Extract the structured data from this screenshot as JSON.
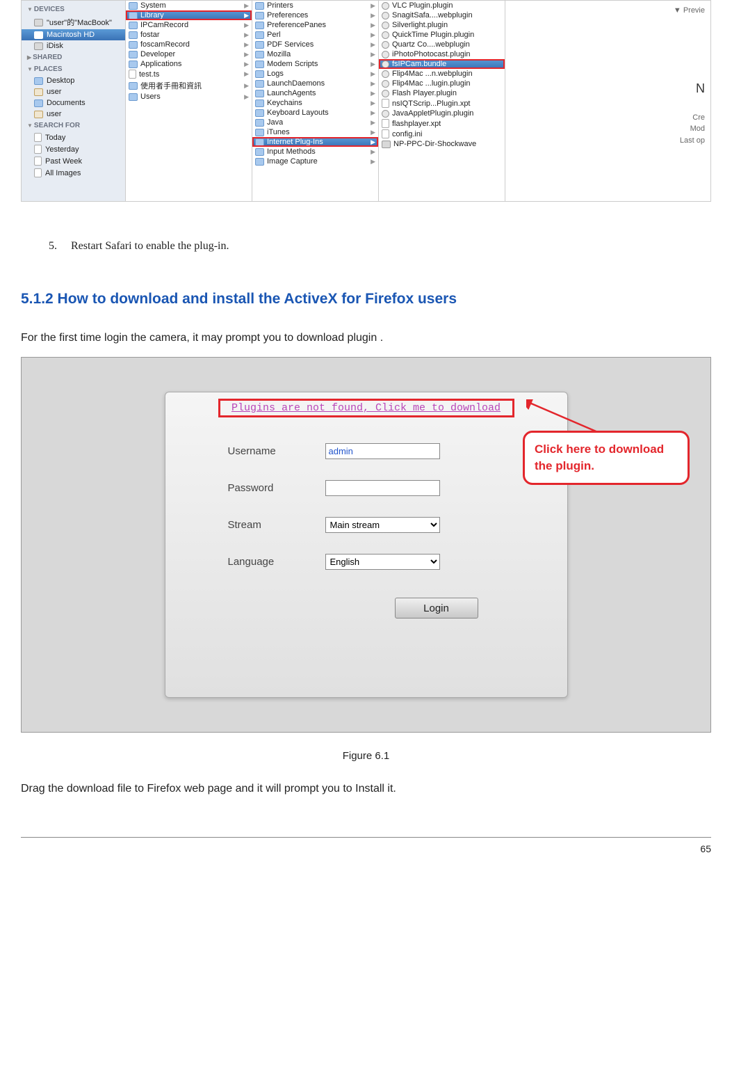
{
  "finder": {
    "sidebar": {
      "sections": [
        {
          "header": "DEVICES",
          "items": [
            {
              "icon": "disk-i",
              "label": "\"user\"的\"MacBook\""
            },
            {
              "icon": "disk-i",
              "label": "Macintosh HD",
              "selected": true
            },
            {
              "icon": "disk-i",
              "label": "iDisk"
            }
          ]
        },
        {
          "header": "SHARED",
          "items": []
        },
        {
          "header": "PLACES",
          "items": [
            {
              "icon": "folder-i",
              "label": "Desktop"
            },
            {
              "icon": "home-i",
              "label": "user"
            },
            {
              "icon": "folder-i",
              "label": "Documents"
            },
            {
              "icon": "home-i",
              "label": "user"
            }
          ]
        },
        {
          "header": "SEARCH FOR",
          "items": [
            {
              "icon": "file-i",
              "label": "Today"
            },
            {
              "icon": "file-i",
              "label": "Yesterday"
            },
            {
              "icon": "file-i",
              "label": "Past Week"
            },
            {
              "icon": "file-i",
              "label": "All Images"
            }
          ]
        }
      ]
    },
    "col1": [
      {
        "label": "System",
        "type": "folder"
      },
      {
        "label": "Library",
        "type": "folder",
        "selected": true,
        "highlighted": true
      },
      {
        "label": "IPCamRecord",
        "type": "folder"
      },
      {
        "label": "fostar",
        "type": "folder"
      },
      {
        "label": "foscamRecord",
        "type": "folder"
      },
      {
        "label": "Developer",
        "type": "folder"
      },
      {
        "label": "Applications",
        "type": "folder"
      },
      {
        "label": "test.ts",
        "type": "file"
      },
      {
        "label": "使用者手冊和資訊",
        "type": "folder"
      },
      {
        "label": "Users",
        "type": "folder"
      }
    ],
    "col2": [
      {
        "label": "Printers",
        "type": "folder"
      },
      {
        "label": "Preferences",
        "type": "folder"
      },
      {
        "label": "PreferencePanes",
        "type": "folder"
      },
      {
        "label": "Perl",
        "type": "folder"
      },
      {
        "label": "PDF Services",
        "type": "folder"
      },
      {
        "label": "Mozilla",
        "type": "folder"
      },
      {
        "label": "Modem Scripts",
        "type": "folder"
      },
      {
        "label": "Logs",
        "type": "folder"
      },
      {
        "label": "LaunchDaemons",
        "type": "folder"
      },
      {
        "label": "LaunchAgents",
        "type": "folder"
      },
      {
        "label": "Keychains",
        "type": "folder"
      },
      {
        "label": "Keyboard Layouts",
        "type": "folder"
      },
      {
        "label": "Java",
        "type": "folder"
      },
      {
        "label": "iTunes",
        "type": "folder"
      },
      {
        "label": "Internet Plug-Ins",
        "type": "folder",
        "selected": true,
        "highlighted": true
      },
      {
        "label": "Input Methods",
        "type": "folder"
      },
      {
        "label": "Image Capture",
        "type": "folder"
      }
    ],
    "col3": [
      {
        "label": "VLC Plugin.plugin",
        "type": "plugin"
      },
      {
        "label": "SnagitSafa....webplugin",
        "type": "plugin"
      },
      {
        "label": "Silverlight.plugin",
        "type": "plugin"
      },
      {
        "label": "QuickTime Plugin.plugin",
        "type": "plugin"
      },
      {
        "label": "Quartz Co....webplugin",
        "type": "plugin"
      },
      {
        "label": "iPhotoPhotocast.plugin",
        "type": "plugin"
      },
      {
        "label": "fsIPCam.bundle",
        "type": "plugin",
        "selected": true,
        "highlighted": true
      },
      {
        "label": "Flip4Mac ...n.webplugin",
        "type": "plugin"
      },
      {
        "label": "Flip4Mac ...lugin.plugin",
        "type": "plugin"
      },
      {
        "label": "Flash Player.plugin",
        "type": "plugin"
      },
      {
        "label": "nsIQTScrip...Plugin.xpt",
        "type": "file"
      },
      {
        "label": "JavaAppletPlugin.plugin",
        "type": "plugin"
      },
      {
        "label": "flashplayer.xpt",
        "type": "file"
      },
      {
        "label": "config.ini",
        "type": "file"
      },
      {
        "label": "NP-PPC-Dir-Shockwave",
        "type": "disk"
      }
    ],
    "detail": {
      "prev": "Previe",
      "cre": "Cre",
      "mod": "Mod",
      "last": "Last op"
    }
  },
  "step": {
    "num": "5.",
    "text": "Restart Safari to enable the plug-in."
  },
  "heading": "5.1.2 How to download and install the ActiveX for Firefox users",
  "para1": "For the first time login the camera, it may prompt you to download plugin .",
  "login": {
    "plugin_link": "Plugins are not found, Click me to download",
    "username_label": "Username",
    "username_value": "admin",
    "password_label": "Password",
    "password_value": "",
    "stream_label": "Stream",
    "stream_value": "Main stream",
    "language_label": "Language",
    "language_value": "English",
    "login_btn": "Login"
  },
  "callout": "Click here to download the plugin.",
  "caption": "Figure 6.1",
  "para2": "Drag the download file to Firefox web page and it will prompt you to Install it.",
  "pageno": "65"
}
